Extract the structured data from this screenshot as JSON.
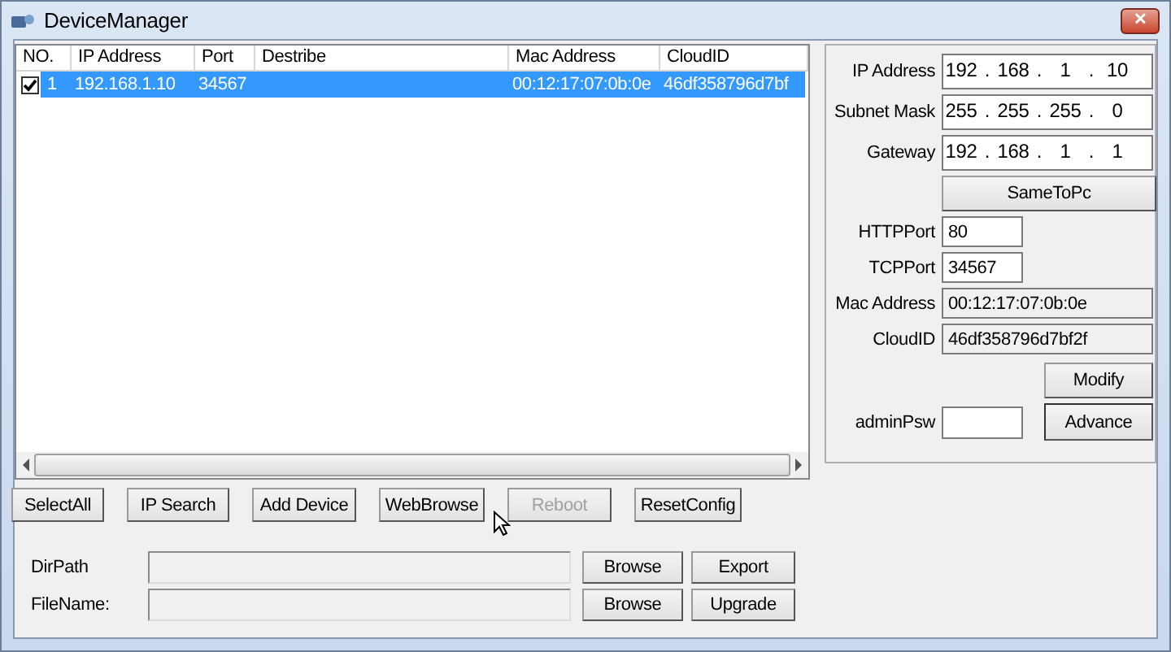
{
  "window": {
    "title": "DeviceManager",
    "close": "✕"
  },
  "device_table": {
    "columns": [
      "NO.",
      "IP Address",
      "Port",
      "Destribe",
      "Mac Address",
      "CloudID"
    ],
    "rows": [
      {
        "checked": true,
        "selected": true,
        "no": "1",
        "ip_address": "192.168.1.10",
        "port": "34567",
        "mac_address": "00:12:17:07:0b:0e",
        "cloud_id": "46df358796d7bf"
      }
    ]
  },
  "settings": {
    "separator": ".",
    "rows": [
      {
        "kind": "ip",
        "label": "IP Address",
        "octets": [
          "192",
          "168",
          "1",
          "10"
        ]
      },
      {
        "kind": "ip",
        "label": "Subnet Mask",
        "octets": [
          "255",
          "255",
          "255",
          "0"
        ]
      },
      {
        "kind": "ip",
        "label": "Gateway",
        "octets": [
          "192",
          "168",
          "1",
          "1"
        ]
      },
      {
        "kind": "button",
        "label": "SameToPc"
      },
      {
        "kind": "port",
        "label": "HTTPPort",
        "value": "80"
      },
      {
        "kind": "port",
        "label": "TCPPort",
        "value": "34567"
      },
      {
        "kind": "info",
        "label": "Mac Address",
        "value": "00:12:17:07:0b:0e"
      },
      {
        "kind": "info",
        "label": "CloudID",
        "value": "46df358796d7bf2f"
      }
    ],
    "modify_button": {
      "label": "Modify",
      "focused": false
    },
    "admin_password": {
      "label": "adminPsw"
    },
    "advance_button": {
      "label": "Advance",
      "focused": true
    }
  },
  "actions": [
    {
      "label": "SelectAll",
      "disabled": false
    },
    {
      "label": "IP Search",
      "disabled": false
    },
    {
      "label": "Add Device",
      "disabled": false
    },
    {
      "label": "WebBrowse",
      "disabled": false
    },
    {
      "label": "Reboot",
      "disabled": true
    },
    {
      "label": "ResetConfig",
      "disabled": false
    }
  ],
  "files": [
    {
      "label": "DirPath",
      "browse": "Browse",
      "action": "Export"
    },
    {
      "label": "FileName:",
      "browse": "Browse",
      "action": "Upgrade"
    }
  ]
}
